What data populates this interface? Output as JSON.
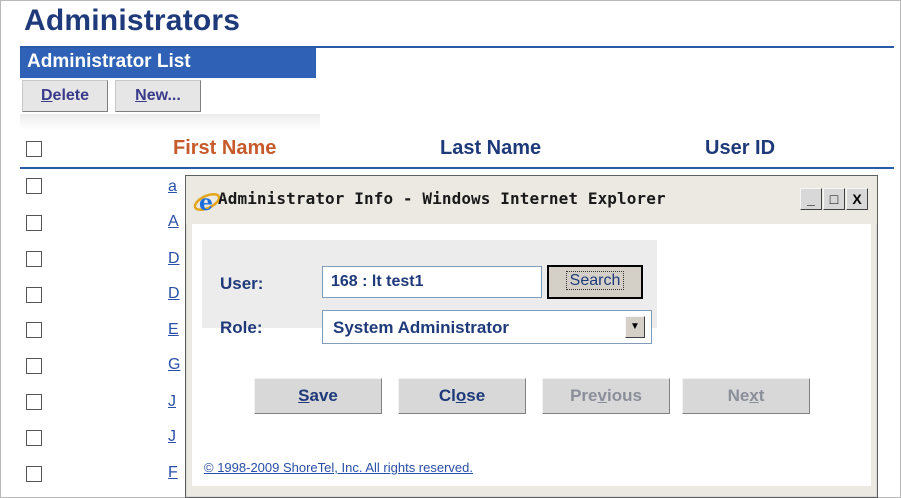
{
  "page": {
    "title": "Administrators",
    "section_title": "Administrator List"
  },
  "toolbar": {
    "delete_label_first": "D",
    "delete_label_rest": "elete",
    "new_label_first": "N",
    "new_label_rest": "ew..."
  },
  "table": {
    "columns": [
      "First Name",
      "Last Name",
      "User ID"
    ],
    "rows_visible_initials": [
      "a",
      "A",
      "D",
      "D",
      "E",
      "G",
      "J",
      "J",
      "F"
    ]
  },
  "dialog": {
    "title": "Administrator Info - Windows Internet Explorer",
    "window_buttons": [
      "_",
      "□",
      "X"
    ],
    "form": {
      "user_label": "User:",
      "user_value": "168 : lt test1",
      "search_label": "Search",
      "role_label": "Role:",
      "role_value": "System Administrator"
    },
    "actions": {
      "save_pre": "",
      "save_u": "S",
      "save_post": "ave",
      "close_pre": "Cl",
      "close_u": "o",
      "close_post": "se",
      "previous_pre": "Pre",
      "previous_u": "v",
      "previous_post": "ious",
      "next_pre": "Ne",
      "next_u": "x",
      "next_post": "t"
    },
    "copyright": "© 1998-2009 ShoreTel, Inc. All rights reserved."
  },
  "colors": {
    "heading_blue": "#1f3a7a",
    "section_bar": "#2f62b6",
    "first_name_header": "#c65a2a",
    "link": "#2a4fa8",
    "disabled_text": "#8a8f99"
  },
  "icons": [
    "ie-icon",
    "minimize-icon",
    "maximize-icon",
    "close-icon",
    "dropdown-arrow-icon"
  ]
}
